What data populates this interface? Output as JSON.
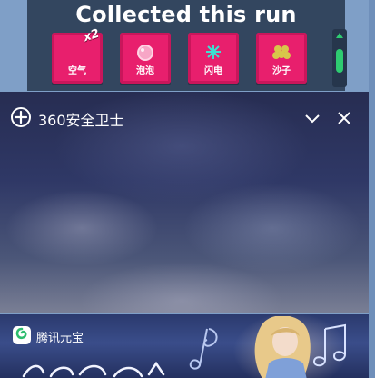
{
  "game": {
    "title": "Collected this run",
    "items": [
      {
        "label": "空气",
        "badge": "x2",
        "icon": "air-icon"
      },
      {
        "label": "泡泡",
        "icon": "bubble-icon"
      },
      {
        "label": "闪电",
        "icon": "lightning-icon"
      },
      {
        "label": "沙子",
        "icon": "sand-icon"
      }
    ]
  },
  "popup": {
    "title": "360安全卫士",
    "controls": {
      "minimize_icon": "chevron-down-icon",
      "close_icon": "close-icon"
    }
  },
  "ad": {
    "brand": "腾讯元宝"
  },
  "colors": {
    "tile": "#e81f6d",
    "panel": "#33465f",
    "scroll_accent": "#2ecc71"
  }
}
